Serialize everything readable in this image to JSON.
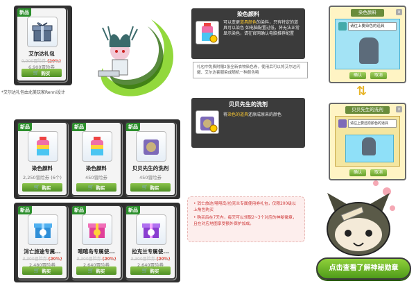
{
  "top_item": {
    "badge": "新品",
    "name": "艾尔达礼包",
    "old_price": "9,900冒险券",
    "discount": "(20%)",
    "price": "6,900冒险券",
    "buy_label": "购买"
  },
  "designer_note": "*艾尔达礼包由北美玩家Renni设计",
  "dye_box": {
    "title": "染色颜料",
    "desc_pre": "可以变更",
    "desc_hl": "道具颜色",
    "desc_post": "的染料，只有特定的道具可以染色\n如电脑配置过低，将无法正常显示染色，请在官网确认电脑推荐配置"
  },
  "info_text": "礼包中免费附赠2张全新衣物染色券，使用后可以将艾尔达闪耀、艾尔达套服染成随机一种颜色哦",
  "remover_box": {
    "title": "贝贝先生的洗剂",
    "desc_pre": "将",
    "desc_hl": "染色的道具",
    "desc_post": "还原成原来的颜色"
  },
  "window1": {
    "title": "染色颜料",
    "prompt": "请往上要染色的道具",
    "ok": "确认",
    "cancel": "取消",
    "close": "x"
  },
  "window2": {
    "title": "贝贝先生的洗剂",
    "prompt": "请往上要还原颜色的道具",
    "ok": "确认",
    "cancel": "取消",
    "close": "x"
  },
  "grid_items": [
    {
      "badge": "新品",
      "name": "染色颜料",
      "old_price": "",
      "discount": "",
      "price": "2,250冒险券 (6个)",
      "buy_label": "购买"
    },
    {
      "badge": "新品",
      "name": "染色颜料",
      "old_price": "",
      "discount": "",
      "price": "450冒险券",
      "buy_label": "购买"
    },
    {
      "badge": "新品",
      "name": "贝贝先生的洗剂",
      "old_price": "",
      "discount": "",
      "price": "450冒险券",
      "buy_label": "购买"
    },
    {
      "badge": "新品",
      "name": "消亡旅途专属...",
      "old_price": "3,300冒险券",
      "discount": "(20%)",
      "price": "2,480冒险券",
      "buy_label": "购买"
    },
    {
      "badge": "新品",
      "name": "嘻嘻岛专属使...",
      "old_price": "3,300冒险券",
      "discount": "(20%)",
      "price": "2,640冒险券",
      "buy_label": "购买"
    },
    {
      "badge": "新品",
      "name": "拉克兰专属使...",
      "old_price": "3,300冒险券",
      "discount": "(20%)",
      "price": "2,640冒险券",
      "buy_label": "购买"
    }
  ],
  "notice": {
    "line1": "• 消亡旅途/嘻嘻岛/拉克兰专属使用券礼包，仅限200级以上角色购买",
    "line2": "• 购买后在7天内，每天可以领取2~3个对应的神秘徽章，且在对应地图享受额外保护加成。"
  },
  "cta_label": "点击查看了解神秘勋章",
  "colors": {
    "accent_green": "#4e8f24",
    "discount_red": "#e23a2a",
    "highlight": "#ffcc33"
  }
}
